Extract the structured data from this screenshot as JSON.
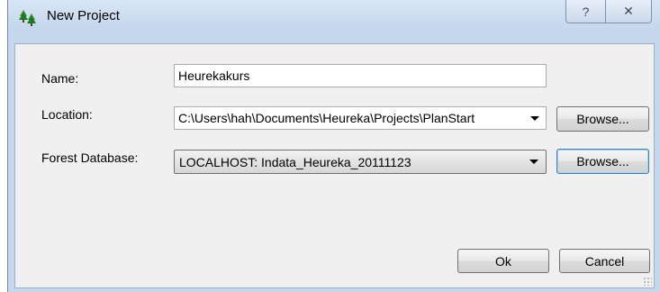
{
  "window": {
    "title": "New Project",
    "icon": "forest-tree-icon",
    "help_glyph": "?",
    "close_glyph": "✕"
  },
  "form": {
    "name_label": "Name:",
    "name_value": "Heurekakurs",
    "location_label": "Location:",
    "location_value": "C:\\Users\\hah\\Documents\\Heureka\\Projects\\PlanStart",
    "location_browse": "Browse...",
    "database_label": "Forest Database:",
    "database_value": "LOCALHOST: Indata_Heureka_20111123",
    "database_browse": "Browse..."
  },
  "buttons": {
    "ok": "Ok",
    "cancel": "Cancel"
  }
}
